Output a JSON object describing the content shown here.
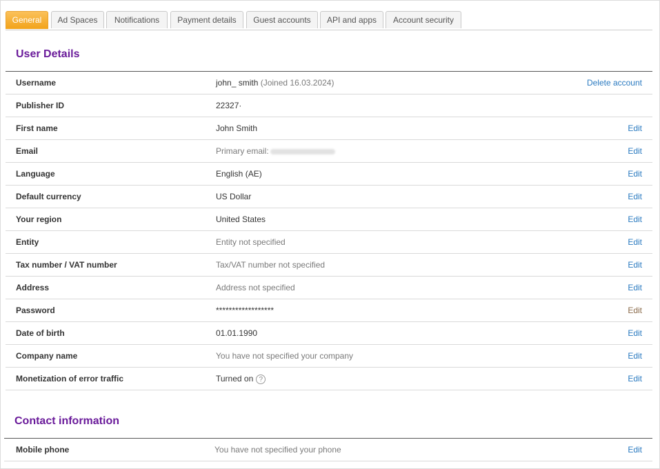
{
  "tabs": [
    "General",
    "Ad Spaces",
    "Notifications",
    "Payment details",
    "Guest accounts",
    "API and apps",
    "Account security"
  ],
  "active_tab": "General",
  "user_details": {
    "title": "User Details",
    "rows": [
      {
        "label": "Username",
        "value": "john_ smith",
        "joined": "(Joined 16.03.2024)",
        "action": "Delete account"
      },
      {
        "label": "Publisher ID",
        "value": "22327·"
      },
      {
        "label": "First name",
        "value": "John Smith",
        "action": "Edit"
      },
      {
        "label": "Email",
        "value": "Primary email:",
        "action": "Edit"
      },
      {
        "label": "Language",
        "value": "English (AE)",
        "action": "Edit"
      },
      {
        "label": "Default currency",
        "value": "US Dollar",
        "action": "Edit"
      },
      {
        "label": "Your region",
        "value": "United States",
        "action": "Edit"
      },
      {
        "label": "Entity",
        "value": "Entity not specified",
        "action": "Edit"
      },
      {
        "label": "Tax number / VAT number",
        "value": "Tax/VAT number not specified",
        "action": "Edit"
      },
      {
        "label": "Address",
        "value": "Address not specified",
        "action": "Edit"
      },
      {
        "label": "Password",
        "value": "******************",
        "action": "Edit"
      },
      {
        "label": "Date of birth",
        "value": "01.01.1990",
        "action": "Edit"
      },
      {
        "label": "Company name",
        "value": "You have not specified your company",
        "action": "Edit"
      },
      {
        "label": "Monetization of error traffic",
        "value": "Turned on",
        "help_icon": "?",
        "action": "Edit"
      }
    ]
  },
  "contact_information": {
    "title": "Contact information",
    "rows": [
      {
        "label": "Mobile phone",
        "value": "You have not specified your phone",
        "action": "Edit"
      }
    ]
  },
  "colors": {
    "accent_tab": "#f2a31a",
    "section_title": "#6a1b9a",
    "link": "#2a7ac0"
  },
  "icons": {
    "help": "question-circle-icon"
  }
}
